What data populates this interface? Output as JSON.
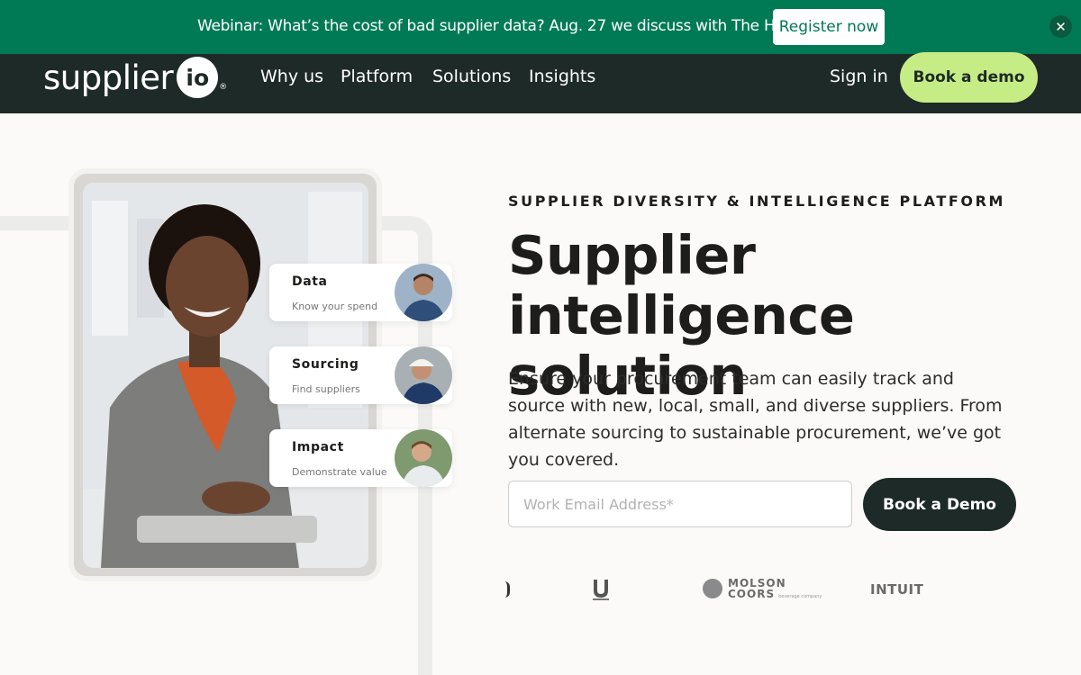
{
  "banner": {
    "text": "Webinar: What’s the cost of bad supplier data? Aug. 27 we discuss with The Hackett Group.",
    "register_label": "Register now",
    "close_icon": "close-icon",
    "background": "#007a55"
  },
  "nav": {
    "logo_text": "supplier",
    "logo_mark": "io",
    "logo_registered": "®",
    "links": [
      "Why us",
      "Platform",
      "Solutions",
      "Insights"
    ],
    "signin_label": "Sign in",
    "demo_label": "Book a demo",
    "background": "#1e2a27",
    "accent": "#c6ec85"
  },
  "cards": [
    {
      "title": "Data",
      "subtitle": "Know your spend"
    },
    {
      "title": "Sourcing",
      "subtitle": "Find suppliers"
    },
    {
      "title": "Impact",
      "subtitle": "Demonstrate value"
    }
  ],
  "hero": {
    "eyebrow": "SUPPLIER DIVERSITY & INTELLIGENCE PLATFORM",
    "headline_line1": "Supplier",
    "headline_line2": "intelligence solution",
    "subtext": "Ensure your procurement team can easily track and source with new, local, small, and diverse suppliers. From alternate sourcing to sustainable procurement, we’ve got you covered.",
    "email_placeholder": "Work Email Address*",
    "cta_label": "Book a Demo"
  },
  "customer_logos": {
    "molson_line1": "MOLSON",
    "molson_line2": "COORS",
    "molson_tag": "beverage company",
    "intuit": "INTUIT"
  }
}
